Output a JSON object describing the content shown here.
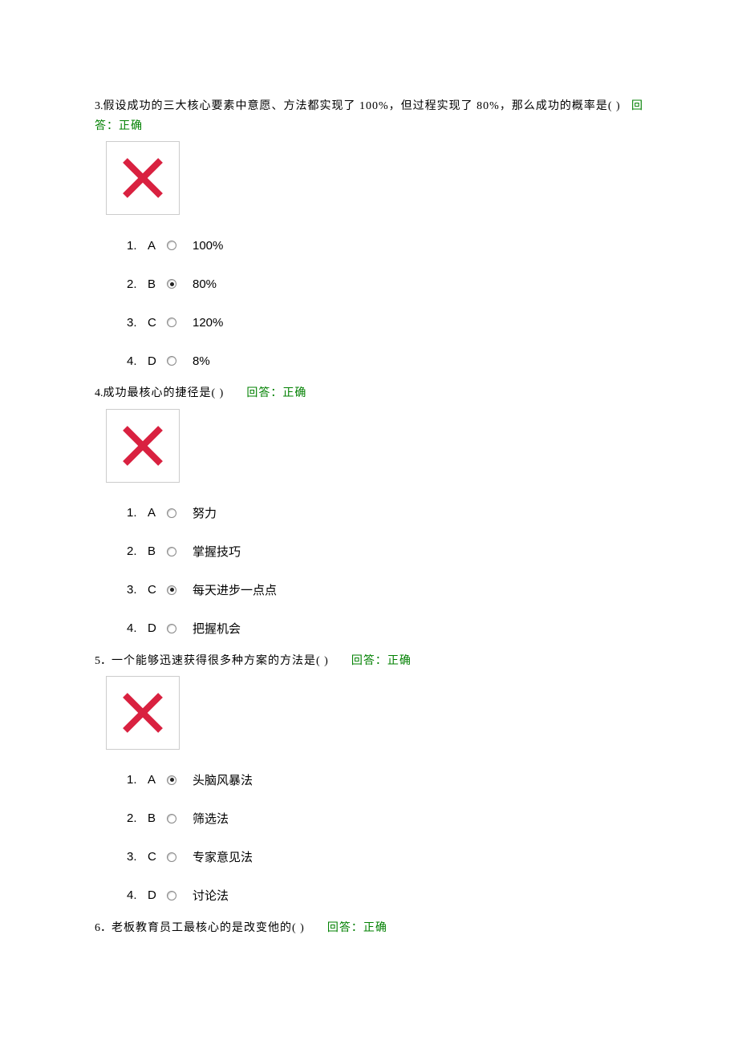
{
  "questions": [
    {
      "number": "3.",
      "text": "假设成功的三大核心要素中意愿、方法都实现了 100%，但过程实现了 80%，那么成功的概率是( )",
      "feedback_prefix": "回",
      "feedback_rest": "答：正确",
      "feedback_style": "wrap",
      "options": [
        {
          "index": "1.",
          "letter": "A",
          "text": "100%",
          "selected": false
        },
        {
          "index": "2.",
          "letter": "B",
          "text": "80%",
          "selected": true
        },
        {
          "index": "3.",
          "letter": "C",
          "text": "120%",
          "selected": false
        },
        {
          "index": "4.",
          "letter": "D",
          "text": "8%",
          "selected": false
        }
      ]
    },
    {
      "number": "4.",
      "text": "成功最核心的捷径是( )",
      "feedback": "回答：正确",
      "feedback_style": "inline",
      "options": [
        {
          "index": "1.",
          "letter": "A",
          "text": "努力",
          "selected": false
        },
        {
          "index": "2.",
          "letter": "B",
          "text": "掌握技巧",
          "selected": false
        },
        {
          "index": "3.",
          "letter": "C",
          "text": "每天进步一点点",
          "selected": true
        },
        {
          "index": "4.",
          "letter": "D",
          "text": "把握机会",
          "selected": false
        }
      ]
    },
    {
      "number": "5．",
      "text": "一个能够迅速获得很多种方案的方法是( )",
      "feedback": "回答：正确",
      "feedback_style": "inline",
      "options": [
        {
          "index": "1.",
          "letter": "A",
          "text": "头脑风暴法",
          "selected": true
        },
        {
          "index": "2.",
          "letter": "B",
          "text": "筛选法",
          "selected": false
        },
        {
          "index": "3.",
          "letter": "C",
          "text": "专家意见法",
          "selected": false
        },
        {
          "index": "4.",
          "letter": "D",
          "text": "讨论法",
          "selected": false
        }
      ]
    },
    {
      "number": "6．",
      "text": "老板教育员工最核心的是改变他的( )",
      "feedback": "回答：正确",
      "feedback_style": "inline",
      "no_body": true,
      "options": []
    }
  ]
}
